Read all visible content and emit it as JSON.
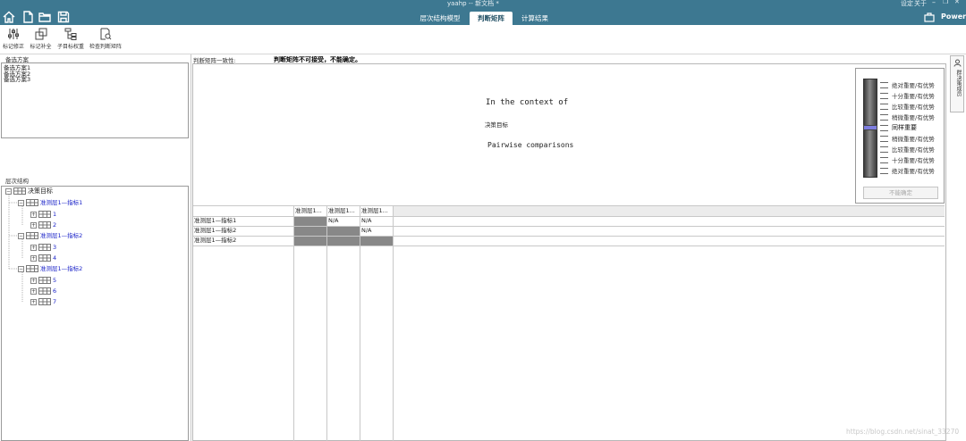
{
  "window": {
    "title": "yaahp -- 新文档 *",
    "top_right": [
      "设定",
      "关于"
    ],
    "tabs": [
      "层次结构模型",
      "判断矩阵",
      "计算结果"
    ],
    "active_tab": 1,
    "power_label": "Power",
    "colors": {
      "titlebar": "#3d7891",
      "gray_cell": "#888888",
      "tree_blue": "#1a22c8"
    }
  },
  "ribbon": {
    "buttons": [
      "标记修正",
      "标记补全",
      "子目标权重",
      "检查判断矩阵"
    ]
  },
  "left": {
    "alternatives_title": "备选方案",
    "alternatives": [
      "备选方案1",
      "备选方案2",
      "备选方案3"
    ],
    "hierarchy_title": "层次结构",
    "tree": {
      "root": "决策目标",
      "groups": [
        {
          "label": "准测层1—指标1",
          "children": [
            "1",
            "2"
          ]
        },
        {
          "label": "准测层1—指标2",
          "children": [
            "3",
            "4"
          ]
        },
        {
          "label": "准测层1—指标2",
          "children": [
            "5",
            "6",
            "7"
          ]
        }
      ]
    }
  },
  "main": {
    "consistency_label": "判断矩阵一致性:",
    "consistency_value": "判断矩阵不可接受，不能确定。",
    "context_line": "In the context of",
    "context_target": "决策目标",
    "pairwise_line": "Pairwise comparisons",
    "scale": {
      "labels": [
        "绝对重要/有优势",
        "十分重要/有优势",
        "比较重要/有优势",
        "稍微重要/有优势",
        "同样重要",
        "稍微重要/有优势",
        "比较重要/有优势",
        "十分重要/有优势",
        "绝对重要/有优势"
      ],
      "confirm_button": "不能确定"
    },
    "grid": {
      "col_headers": [
        "准测层1...",
        "准测层1...",
        "准测层1..."
      ],
      "rows": [
        {
          "label": "准测层1—指标1",
          "cells": [
            "#",
            "N/A",
            "N/A"
          ]
        },
        {
          "label": "准测层1—指标2",
          "cells": [
            "#",
            "#",
            "N/A"
          ]
        },
        {
          "label": "准测层1—指标2",
          "cells": [
            "#",
            "#",
            "#"
          ]
        }
      ]
    },
    "side_tab": "群决策成员",
    "watermark": "https://blog.csdn.net/sinat_33270"
  }
}
